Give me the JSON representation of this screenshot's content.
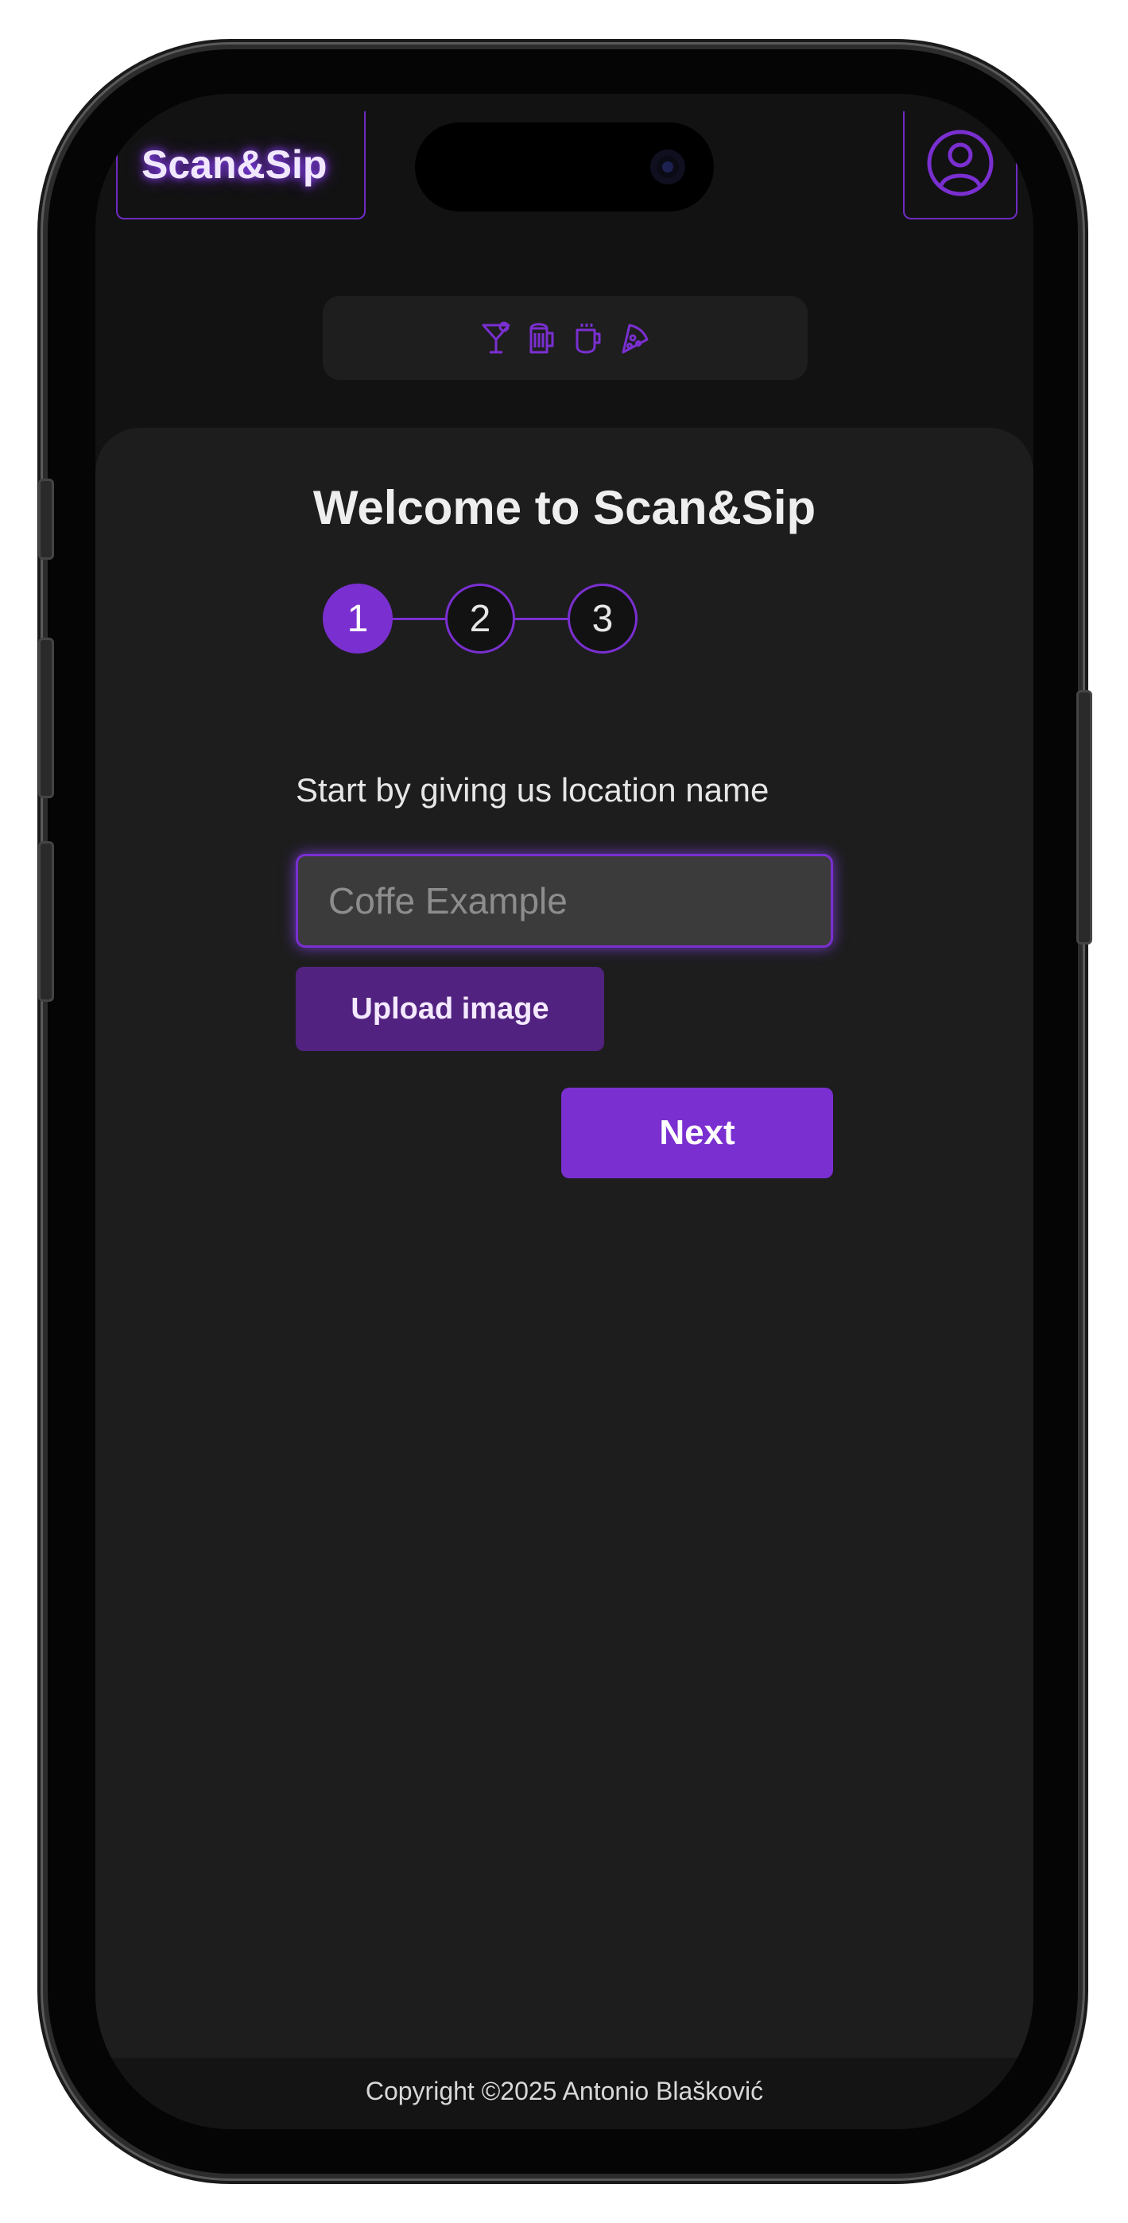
{
  "app": {
    "brand": "Scan&Sip",
    "accent_color": "#7a2fd0"
  },
  "header": {
    "logo_text": "Scan&Sip",
    "profile_icon": "user-circle-icon"
  },
  "category_bar": {
    "icons": [
      "cocktail-icon",
      "beer-mug-icon",
      "coffee-cup-icon",
      "pizza-slice-icon"
    ]
  },
  "main": {
    "title": "Welcome to Scan&Sip",
    "steps": [
      "1",
      "2",
      "3"
    ],
    "active_step": 1,
    "prompt": "Start by giving us location name",
    "location_input": {
      "value": "",
      "placeholder": "Coffe Example"
    },
    "upload_label": "Upload image",
    "next_label": "Next"
  },
  "footer": {
    "copyright": "Copyright ©2025 Antonio Blašković"
  }
}
